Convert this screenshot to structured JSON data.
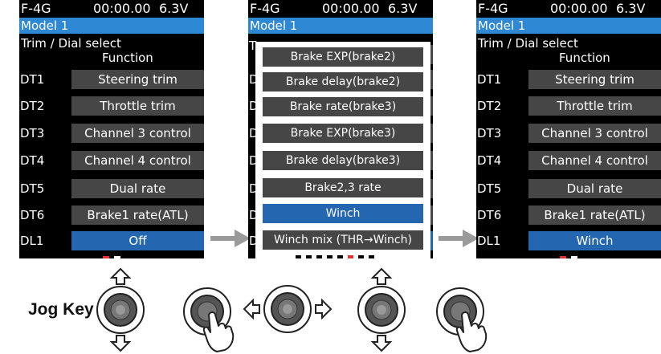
{
  "status_bar": {
    "model": "F-4G",
    "time": "00:00.00",
    "voltage": "6.3V"
  },
  "model_name": "Model 1",
  "page_title": "Trim / Dial select",
  "column_header": "Function",
  "rows": [
    {
      "label": "DT1",
      "function": "Steering trim"
    },
    {
      "label": "DT2",
      "function": "Throttle trim"
    },
    {
      "label": "DT3",
      "function": "Channel 3 control"
    },
    {
      "label": "DT4",
      "function": "Channel 4 control"
    },
    {
      "label": "DT5",
      "function": "Dual rate"
    },
    {
      "label": "DT6",
      "function": "Brake1 rate(ATL)"
    },
    {
      "label": "DL1",
      "function": "Off"
    }
  ],
  "dl1_after": "Winch",
  "popup_options": [
    "Brake EXP(brake2)",
    "Brake delay(brake2)",
    "Brake rate(brake3)",
    "Brake EXP(brake3)",
    "Brake delay(brake3)",
    "Brake2,3 rate",
    "Winch",
    "Winch mix (THR→Winch)"
  ],
  "popup_selected_index": 6,
  "popup_page_indicator": {
    "pages": 8,
    "current": 5
  },
  "jog_key_label": "Jog Key",
  "colors": {
    "title_bar": "#2f88d3",
    "selected": "#2466b0",
    "button": "#464646",
    "indicator_red": "#e53030"
  }
}
